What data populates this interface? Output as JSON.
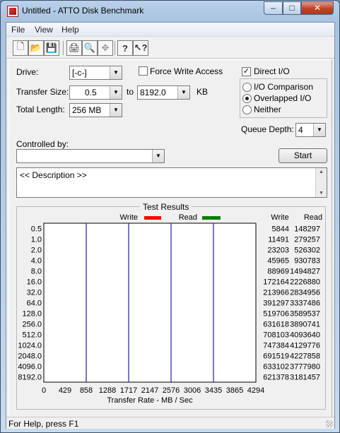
{
  "window": {
    "title": "Untitled - ATTO Disk Benchmark",
    "controls": {
      "minimize": "–",
      "maximize": "□",
      "close": "✕"
    }
  },
  "menu": [
    "File",
    "View",
    "Help"
  ],
  "toolbar": {
    "icons": [
      "new-icon",
      "open-icon",
      "save-icon",
      "print-icon",
      "print-preview-icon",
      "move-icon",
      "help-icon",
      "context-help-icon"
    ]
  },
  "settings": {
    "drive_label": "Drive:",
    "drive_value": "[-c-]",
    "force_write_label": "Force Write Access",
    "force_write_checked": false,
    "direct_io_label": "Direct I/O",
    "direct_io_checked": true,
    "transfer_size_label": "Transfer Size:",
    "transfer_size_from": "0.5",
    "to_label": "to",
    "transfer_size_to": "8192.0",
    "kb_label": "KB",
    "total_length_label": "Total Length:",
    "total_length_value": "256 MB",
    "io_modes": [
      {
        "label": "I/O Comparison",
        "selected": false
      },
      {
        "label": "Overlapped I/O",
        "selected": true
      },
      {
        "label": "Neither",
        "selected": false
      }
    ],
    "queue_depth_label": "Queue Depth:",
    "queue_depth_value": "4",
    "controlled_by_label": "Controlled by:",
    "controlled_by_value": "",
    "start_label": "Start",
    "description_text": "<< Description >>"
  },
  "results_title": "Test Results",
  "status": "For Help, press F1",
  "chart_data": {
    "type": "bar",
    "orientation": "horizontal",
    "categories": [
      "0.5",
      "1.0",
      "2.0",
      "4.0",
      "8.0",
      "16.0",
      "32.0",
      "64.0",
      "128.0",
      "256.0",
      "512.0",
      "1024.0",
      "2048.0",
      "4096.0",
      "8192.0"
    ],
    "series": [
      {
        "name": "Write",
        "color": "#ff0000",
        "values": [
          5844,
          11491,
          23203,
          45965,
          88969,
          172164,
          213966,
          391297,
          519706,
          631618,
          708103,
          747384,
          691519,
          633102,
          621378
        ]
      },
      {
        "name": "Read",
        "color": "#008000",
        "values": [
          148297,
          279257,
          526302,
          930783,
          1494827,
          2226880,
          2834956,
          3337486,
          3589537,
          3890741,
          4093640,
          4129776,
          4227858,
          3777980,
          3181457
        ]
      }
    ],
    "column_headers": [
      "Write",
      "Read"
    ],
    "xlabel": "Transfer Rate - MB / Sec",
    "xticks": [
      "0",
      "429",
      "858",
      "1288",
      "1717",
      "2147",
      "2576",
      "3006",
      "3435",
      "3865",
      "4294"
    ],
    "xlim": [
      0,
      4294
    ],
    "value_scale": "bytes per second; axis shown in MB/sec",
    "gridlines": "vertical, blue"
  }
}
